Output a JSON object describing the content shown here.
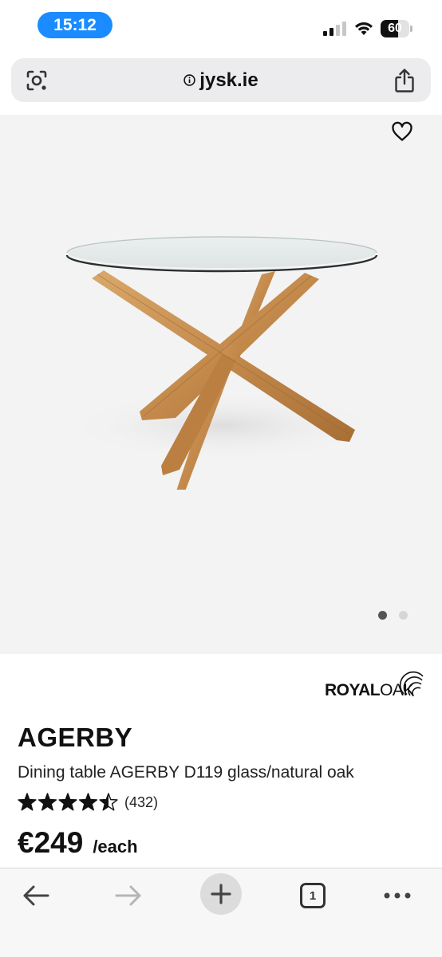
{
  "status_bar": {
    "time": "15:12",
    "battery_level": "60",
    "battery_fraction": 0.6,
    "signal_bars_active": 2,
    "accent_color": "#1a8cff"
  },
  "browser": {
    "url": "jysk.ie",
    "icons": {
      "lens": "camera-search-icon",
      "info": "info-icon",
      "share": "share-icon"
    }
  },
  "gallery": {
    "favorite_icon": "heart-icon",
    "image_count": 2,
    "active_index": 0
  },
  "product": {
    "brand_main": "ROYAL",
    "brand_accent": "OAK",
    "name": "AGERBY",
    "description": "Dining table AGERBY D119 glass/natural oak",
    "rating": 4.5,
    "max_rating": 5,
    "review_count": "(432)",
    "price": "€249",
    "price_unit": "/each"
  },
  "toolbar": {
    "back_icon": "arrow-left-icon",
    "forward_icon": "arrow-right-icon",
    "new_tab_icon": "plus-icon",
    "tab_count": "1",
    "more_icon": "more-dots-icon"
  }
}
